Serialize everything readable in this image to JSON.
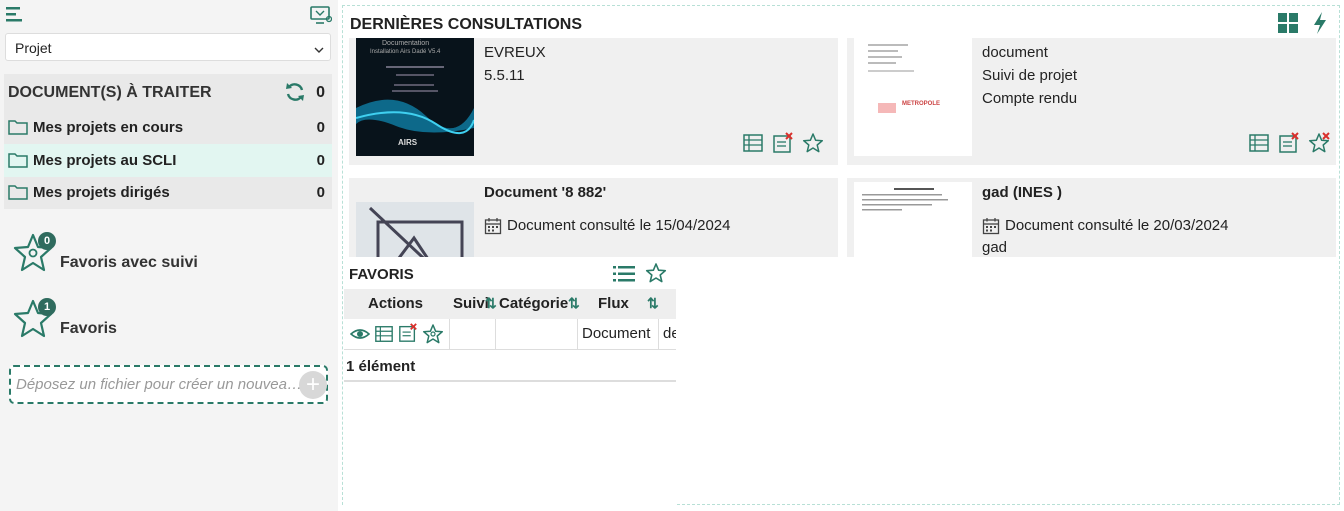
{
  "colors": {
    "accent": "#2a7a68",
    "active_row": "#e2f6f1",
    "danger": "#d9302c"
  },
  "sidebar": {
    "select_value": "Projet",
    "todo": {
      "heading": "DOCUMENT(S) À TRAITER",
      "count": "0",
      "items": [
        {
          "label": "Mes projets en cours",
          "count": "0"
        },
        {
          "label": "Mes projets au SCLI",
          "count": "0"
        },
        {
          "label": "Mes projets dirigés",
          "count": "0"
        }
      ]
    },
    "favorites": [
      {
        "label": "Favoris avec suivi",
        "badge": "0"
      },
      {
        "label": "Favoris",
        "badge": "1"
      }
    ],
    "drop_placeholder": "Déposez un fichier pour créer un nouveau document"
  },
  "main": {
    "title": "DERNIÈRES CONSULTATIONS",
    "cards": [
      {
        "lines": [
          "EVREUX",
          "5.5.11"
        ],
        "thumb_lines": [
          "Documentation",
          "Installation Airs Dadé V5.4"
        ],
        "thumb_brand": "AIRS"
      },
      {
        "lines": [
          "document",
          "Suivi de projet",
          "Compte rendu"
        ],
        "thumb_brand": "METROPOLE"
      },
      {
        "title": "Document '8 882'",
        "consulted": "Document consulté le 15/04/2024"
      },
      {
        "title": "gad (INES )",
        "consulted": "Document consulté le 20/03/2024",
        "extra": "gad"
      }
    ]
  },
  "favoris": {
    "title": "FAVORIS",
    "columns": [
      "Actions",
      "Suivi",
      "Catégorie",
      "Flux"
    ],
    "row": {
      "flux": "Document",
      "next": "de"
    },
    "count_label": "1 élément"
  }
}
